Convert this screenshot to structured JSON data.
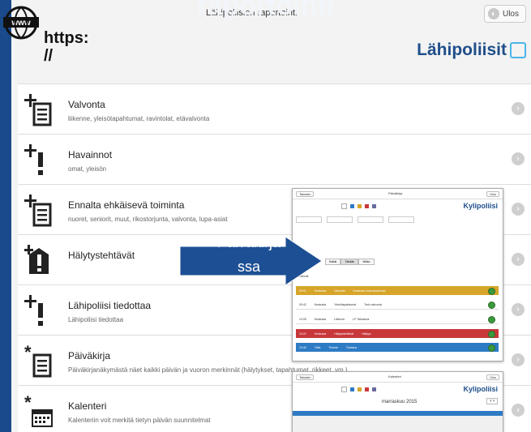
{
  "slide": {
    "title": "raportointi"
  },
  "web_badge": {
    "url_text_line1": "https:",
    "url_text_line2": "//"
  },
  "header": {
    "title": "Lähipoliisien raportointi",
    "exit_label": "Ulos",
    "brand": "Lähipoliisit"
  },
  "menu": [
    {
      "title": "Valvonta",
      "subtitle": "liikenne, yleisötapahtumat, ravintolat, etävalvonta",
      "icon": "add-document-icon"
    },
    {
      "title": "Havainnot",
      "subtitle": "omat, yleisön",
      "icon": "add-exclamation-icon"
    },
    {
      "title": "Ennalta ehkäisevä toiminta",
      "subtitle": "nuoret, seniorit, muut, rikostorjunta, valvonta, lupa-asiat",
      "icon": "add-document-icon"
    },
    {
      "title": "Hälytystehtävät",
      "subtitle": "",
      "icon": "alarm-exclamation-icon"
    },
    {
      "title": "Lähipoliisi tiedottaa",
      "subtitle": "Lähipoliisi tiedottaa",
      "icon": "add-exclamation-icon"
    },
    {
      "title": "Päiväkirja",
      "subtitle": "Päiväkirjanäkymästä näet kaikki päivän ja vuoron merkinnät (hälytykset, tapahtumat, rikkeet, ym.)",
      "icon": "star-document-icon"
    },
    {
      "title": "Kalenteri",
      "subtitle": "Kalenteriin voit merkitä tietyn päivän suunnitelmat",
      "icon": "calendar-icon"
    }
  ],
  "callout": {
    "text": "Päiväkirja\nssa"
  },
  "preview_diary": {
    "back": "Takaisin",
    "title": "Päiväkirja",
    "exit": "Ulos",
    "logo": "Kylipoliisi",
    "section_label": "Merkinnät",
    "tabs": [
      "Kaikki",
      "Tänään",
      "Viikko"
    ],
    "rows": [
      {
        "color": "#d6a52a",
        "time": "09:01",
        "where": "Keskusta",
        "type": "Valvonta",
        "text": "Keskusta nopeusvalvonta"
      },
      {
        "color": "#ffffff",
        "time": "09:42",
        "where": "Keskusta",
        "type": "Yleisötapahtumat",
        "text": "Torin valvonta"
      },
      {
        "color": "#ffffff",
        "time": "10:05",
        "where": "Keskusta",
        "type": "Liikenne",
        "text": "LP Tarkastus"
      },
      {
        "color": "#c8373a",
        "time": "10:22",
        "where": "Keskusta",
        "type": "Hälytystehtävät",
        "text": "Hälytys"
      },
      {
        "color": "#2d7bc4",
        "time": "10:40",
        "where": "Ylläs",
        "type": "Tiedote",
        "text": "Tiedotus"
      }
    ]
  },
  "preview_calendar": {
    "back": "Takaisin",
    "title": "Kalenteri",
    "exit": "Ulos",
    "logo": "Kylipoliisi",
    "month": "marraskuu 2015"
  }
}
